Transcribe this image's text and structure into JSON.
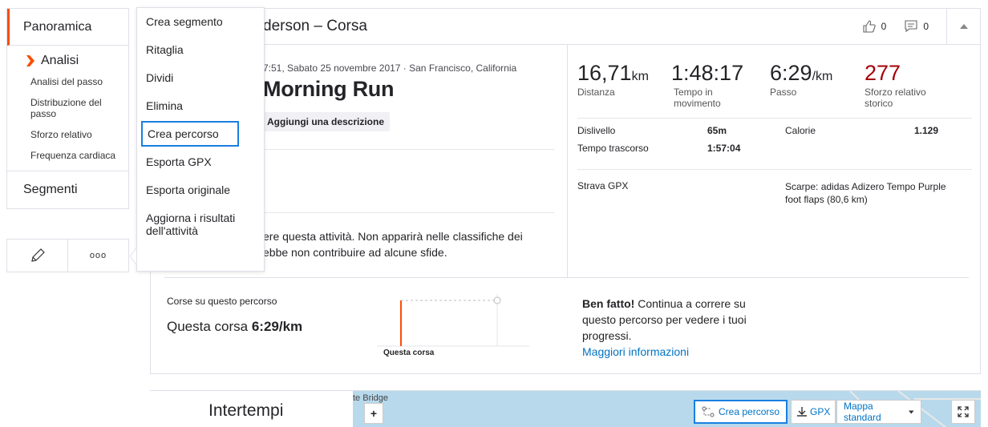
{
  "sidebar": {
    "overview": "Panoramica",
    "analysis": "Analisi",
    "sub_items": [
      "Analisi del passo",
      "Distribuzione del passo",
      "Sforzo relativo",
      "Frequenza cardiaca"
    ],
    "segments": "Segmenti",
    "more_glyph": "ooo"
  },
  "header": {
    "title": "derson – Corsa",
    "kudos_count": "0",
    "comments_count": "0"
  },
  "activity": {
    "meta": "7:51, Sabato 25 novembre 2017 · San Francisco, California",
    "title": "Morning Run",
    "add_description": "Aggiungi una descrizione",
    "warning_line1": "ere questa attività. Non apparirà nelle classifiche dei",
    "warning_line2": "ebbe non contribuire ad alcune sfide."
  },
  "stats": {
    "distance_value": "16,71",
    "distance_unit": "km",
    "distance_label": "Distanza",
    "moving_time_value": "1:48:17",
    "moving_time_label": "Tempo in movimento",
    "pace_value": "6:29",
    "pace_unit": "/km",
    "pace_label": "Passo",
    "relative_effort_value": "277",
    "relative_effort_label": "Sforzo relativo storico",
    "elevation_label": "Dislivello",
    "elevation_value": "65m",
    "calories_label": "Calorie",
    "calories_value": "1.129",
    "elapsed_label": "Tempo trascorso",
    "elapsed_value": "1:57:04",
    "device": "Strava GPX",
    "shoes": "Scarpe: adidas Adizero Tempo Purple foot flaps (80,6 km)"
  },
  "route": {
    "caption": "Corse su questo percorso",
    "run_prefix": "Questa corsa",
    "run_pace": "6:29/km",
    "chart_label": "Questa corsa",
    "praise_bold": "Ben fatto!",
    "praise_text": " Continua a correre su questo percorso per vedere i tuoi progressi.",
    "more_info": "Maggiori informazioni"
  },
  "menu": {
    "items": [
      "Crea segmento",
      "Ritaglia",
      "Dividi",
      "Elimina",
      "Crea percorso",
      "Esporta GPX",
      "Esporta originale",
      "Aggiorna i risultati dell'attività"
    ]
  },
  "lower": {
    "splits_title": "Intertempi",
    "map_label": "te Bridge",
    "zoom_in": "+",
    "create_route": "Crea percorso",
    "gpx": "GPX",
    "map_type": "Mappa standard"
  },
  "colors": {
    "accent": "#fc4c02",
    "effort_red": "#a40009",
    "link": "#0073c4",
    "focus_ring": "#1a7fe0"
  }
}
